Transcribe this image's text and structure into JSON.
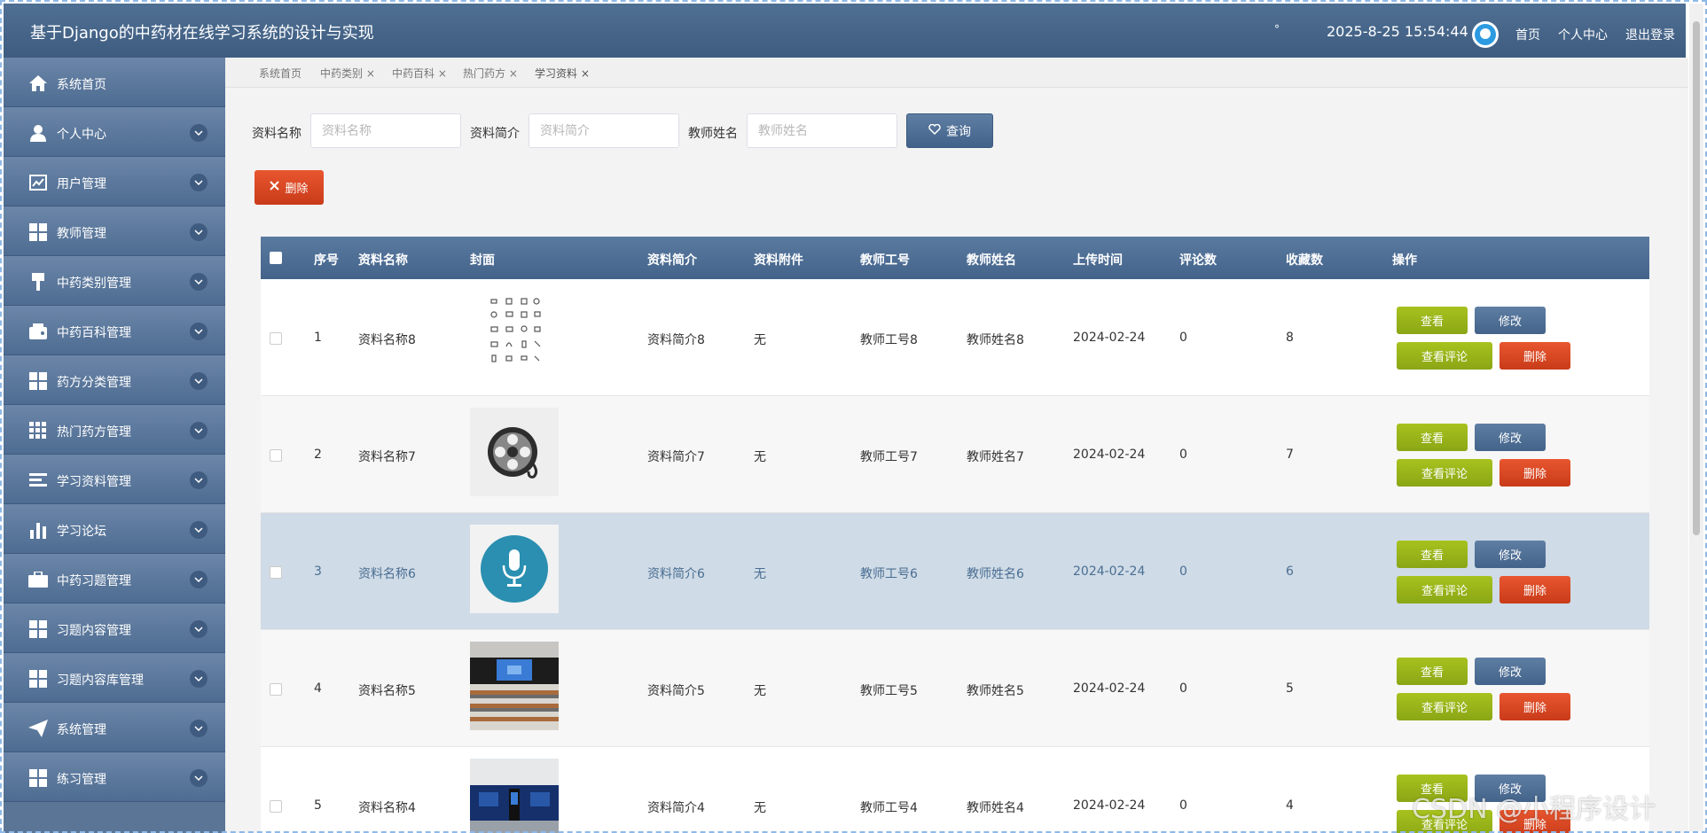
{
  "header": {
    "title": "基于Django的中药材在线学习系统的设计与实现",
    "dot": "°",
    "datetime": "2025-8-25 15:54:44",
    "links": [
      "首页",
      "个人中心",
      "退出登录"
    ]
  },
  "sidebar": {
    "items": [
      {
        "label": "系统首页",
        "icon": "home-icon"
      },
      {
        "label": "个人中心",
        "icon": "user-icon"
      },
      {
        "label": "用户管理",
        "icon": "chart-line-icon"
      },
      {
        "label": "教师管理",
        "icon": "grid-icon"
      },
      {
        "label": "中药类别管理",
        "icon": "brush-icon"
      },
      {
        "label": "中药百科管理",
        "icon": "wallet-icon"
      },
      {
        "label": "药方分类管理",
        "icon": "grid-icon"
      },
      {
        "label": "热门药方管理",
        "icon": "apps-icon"
      },
      {
        "label": "学习资料管理",
        "icon": "list-icon"
      },
      {
        "label": "学习论坛",
        "icon": "bar-chart-icon"
      },
      {
        "label": "中药习题管理",
        "icon": "briefcase-icon"
      },
      {
        "label": "习题内容管理",
        "icon": "grid-icon"
      },
      {
        "label": "习题内容库管理",
        "icon": "grid-icon"
      },
      {
        "label": "系统管理",
        "icon": "paper-plane-icon"
      },
      {
        "label": "练习管理",
        "icon": "grid-icon"
      }
    ]
  },
  "tabs": [
    "系统首页",
    "中药类别 ×",
    "中药百科 ×",
    "热门药方 ×",
    "学习资料 ×"
  ],
  "search": {
    "name_label": "资料名称",
    "name_placeholder": "资料名称",
    "intro_label": "资料简介",
    "intro_placeholder": "资料简介",
    "teacher_label": "教师姓名",
    "teacher_placeholder": "教师姓名",
    "query_label": "查询"
  },
  "delete_label": "删除",
  "table": {
    "headers": [
      "序号",
      "资料名称",
      "封面",
      "资料简介",
      "资料附件",
      "教师工号",
      "教师姓名",
      "上传时间",
      "评论数",
      "收藏数",
      "操作"
    ],
    "rows": [
      {
        "no": "1",
        "name": "资料名称8",
        "cover": "icon-sheet-cover",
        "intro": "资料简介8",
        "attach": "无",
        "tid": "教师工号8",
        "tname": "教师姓名8",
        "time": "2024-02-24",
        "comments": "0",
        "favs": "8"
      },
      {
        "no": "2",
        "name": "资料名称7",
        "cover": "film-reel-cover",
        "intro": "资料简介7",
        "attach": "无",
        "tid": "教师工号7",
        "tname": "教师姓名7",
        "time": "2024-02-24",
        "comments": "0",
        "favs": "7"
      },
      {
        "no": "3",
        "name": "资料名称6",
        "cover": "microphone-cover",
        "intro": "资料简介6",
        "attach": "无",
        "tid": "教师工号6",
        "tname": "教师姓名6",
        "time": "2024-02-24",
        "comments": "0",
        "favs": "6"
      },
      {
        "no": "4",
        "name": "资料名称5",
        "cover": "classroom-cover",
        "intro": "资料简介5",
        "attach": "无",
        "tid": "教师工号5",
        "tname": "教师姓名5",
        "time": "2024-02-24",
        "comments": "0",
        "favs": "5"
      },
      {
        "no": "5",
        "name": "资料名称4",
        "cover": "lecture-hall-cover",
        "intro": "资料简介4",
        "attach": "无",
        "tid": "教师工号4",
        "tname": "教师姓名4",
        "time": "2024-02-24",
        "comments": "0",
        "favs": "4"
      }
    ],
    "actions": {
      "view": "查看",
      "edit": "修改",
      "comments": "查看评论",
      "delete": "删除"
    }
  },
  "watermark": "CSDN @小程序设计"
}
